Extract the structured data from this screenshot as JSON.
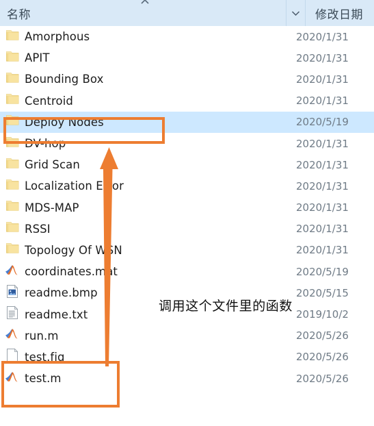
{
  "header": {
    "name_column": "名称",
    "date_column": "修改日期",
    "sort_caret_icon": "caret-up-icon",
    "chevron_icon": "chevron-down-icon"
  },
  "files": [
    {
      "name": "Amorphous",
      "date": "2020/1/31",
      "icon": "folder-icon",
      "selected": false
    },
    {
      "name": "APIT",
      "date": "2020/1/31",
      "icon": "folder-icon",
      "selected": false
    },
    {
      "name": "Bounding Box",
      "date": "2020/1/31",
      "icon": "folder-icon",
      "selected": false
    },
    {
      "name": "Centroid",
      "date": "2020/1/31",
      "icon": "folder-icon",
      "selected": false
    },
    {
      "name": "Deploy Nodes",
      "date": "2020/5/19",
      "icon": "folder-icon",
      "selected": true
    },
    {
      "name": "DV-hop",
      "date": "2020/1/31",
      "icon": "folder-icon",
      "selected": false
    },
    {
      "name": "Grid Scan",
      "date": "2020/1/31",
      "icon": "folder-icon",
      "selected": false
    },
    {
      "name": "Localization Error",
      "date": "2020/1/31",
      "icon": "folder-icon",
      "selected": false
    },
    {
      "name": "MDS-MAP",
      "date": "2020/1/31",
      "icon": "folder-icon",
      "selected": false
    },
    {
      "name": "RSSI",
      "date": "2020/1/31",
      "icon": "folder-icon",
      "selected": false
    },
    {
      "name": "Topology Of WSN",
      "date": "2020/1/31",
      "icon": "folder-icon",
      "selected": false
    },
    {
      "name": "coordinates.mat",
      "date": "2020/5/19",
      "icon": "matlab-icon",
      "selected": false
    },
    {
      "name": "readme.bmp",
      "date": "2020/5/15",
      "icon": "bitmap-icon",
      "selected": false
    },
    {
      "name": "readme.txt",
      "date": "2019/10/2",
      "icon": "text-file-icon",
      "selected": false
    },
    {
      "name": "run.m",
      "date": "2020/5/26",
      "icon": "matlab-icon",
      "selected": false
    },
    {
      "name": "test.fig",
      "date": "2020/5/26",
      "icon": "blank-file-icon",
      "selected": false
    },
    {
      "name": "test.m",
      "date": "2020/5/26",
      "icon": "matlab-icon",
      "selected": false
    }
  ],
  "annotations": {
    "note_text": "调用这个文件里的函数",
    "highlight_color": "#ed7d31",
    "arrow_icon": "up-arrow-icon",
    "box_deploy_target": "Deploy Nodes",
    "box_test_target": "test.fig / test.m"
  },
  "colors": {
    "selection": "#cde8ff",
    "header_background": "#d9e9f7",
    "folder": "#f5dd92",
    "annotation_orange": "#ed7d31"
  }
}
